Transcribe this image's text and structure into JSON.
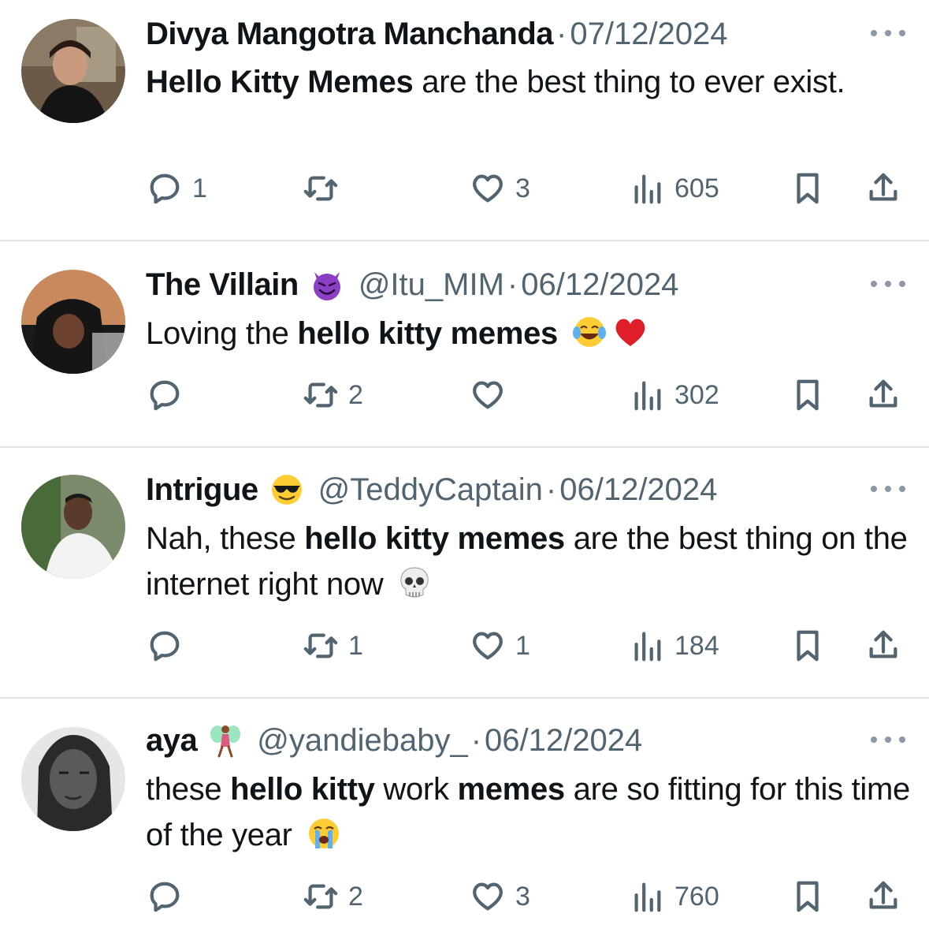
{
  "tweets": [
    {
      "name": "Divya Mangotra Manchanda",
      "handle": "",
      "separator": "·",
      "date": "07/12/2024",
      "badge_icon": "",
      "text_parts": [
        {
          "t": "Hello Kitty Memes",
          "bold": true
        },
        {
          "t": " are the best thing to ever exist.",
          "bold": false
        }
      ],
      "replies": "1",
      "retweets": "",
      "likes": "3",
      "views": "605"
    },
    {
      "name": "The Villain",
      "handle": "@Itu_MIM",
      "separator": "·",
      "date": "06/12/2024",
      "badge_icon": "devil-emoji",
      "text_parts": [
        {
          "t": "Loving the ",
          "bold": false
        },
        {
          "t": "hello kitty memes",
          "bold": true
        }
      ],
      "trailing_emojis": [
        "tears-of-joy-emoji",
        "red-heart-emoji"
      ],
      "replies": "",
      "retweets": "2",
      "likes": "",
      "views": "302"
    },
    {
      "name": "Intrigue",
      "handle": "@TeddyCaptain",
      "separator": "·",
      "date": "06/12/2024",
      "badge_icon": "sunglasses-emoji",
      "text_parts": [
        {
          "t": "Nah, these ",
          "bold": false
        },
        {
          "t": "hello kitty memes",
          "bold": true
        },
        {
          "t": " are the best thing on the internet right now",
          "bold": false
        }
      ],
      "trailing_emojis": [
        "skull-emoji"
      ],
      "replies": "",
      "retweets": "1",
      "likes": "1",
      "views": "184"
    },
    {
      "name": "aya",
      "handle": "@yandiebaby_",
      "separator": "·",
      "date": "06/12/2024",
      "badge_icon": "fairy-emoji",
      "text_parts": [
        {
          "t": "these ",
          "bold": false
        },
        {
          "t": "hello kitty",
          "bold": true
        },
        {
          "t": " work ",
          "bold": false
        },
        {
          "t": "memes",
          "bold": true
        },
        {
          "t": " are so fitting for this time of the year",
          "bold": false
        }
      ],
      "trailing_emojis": [
        "loudly-crying-emoji"
      ],
      "replies": "",
      "retweets": "2",
      "likes": "3",
      "views": "760"
    }
  ],
  "colors": {
    "text": "#0f1419",
    "muted": "#536471",
    "divider": "#e1e4e8"
  }
}
